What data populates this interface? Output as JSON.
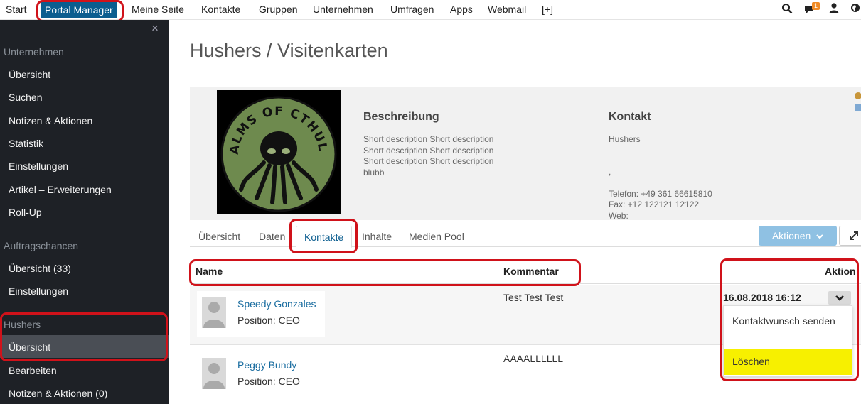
{
  "topnav": {
    "items": [
      "Start",
      "Portal Manager",
      "Meine Seite",
      "Kontakte",
      "Gruppen",
      "Unternehmen",
      "Umfragen",
      "Apps",
      "Webmail",
      "[+]"
    ],
    "active_index": 1,
    "notification_count": "1",
    "icons": [
      "search-icon",
      "chat-icon",
      "user-icon",
      "globe-icon"
    ]
  },
  "sidebar": {
    "close_symbol": "×",
    "sections": [
      {
        "title": "Unternehmen",
        "items": [
          "Übersicht",
          "Suchen",
          "Notizen & Aktionen",
          "Statistik",
          "Einstellungen",
          "Artikel – Erweiterungen",
          "Roll-Up"
        ]
      },
      {
        "title": "Auftragschancen",
        "items": [
          "Übersicht (33)",
          "Einstellungen"
        ]
      },
      {
        "title": "Hushers",
        "items": [
          "Übersicht",
          "Bearbeiten",
          "Notizen & Aktionen (0)"
        ],
        "active_item": "Übersicht"
      }
    ]
  },
  "page": {
    "title": "Hushers / Visitenkarten"
  },
  "card": {
    "logo_text": "REALMS OF CTHULHU",
    "description_heading": "Beschreibung",
    "description_lines": [
      "Short description Short description",
      "Short description Short description",
      "Short description Short description",
      "blubb"
    ],
    "contact_heading": "Kontakt",
    "contact_name": "Hushers",
    "contact_comma": ",",
    "phone": "Telefon: +49 361 66615810",
    "fax": "Fax: +12 122121 12122",
    "web": "Web:"
  },
  "tabs": {
    "items": [
      "Übersicht",
      "Daten",
      "Kontakte",
      "Inhalte",
      "Medien Pool"
    ],
    "active": "Kontakte"
  },
  "actions": {
    "button_label": "Aktionen"
  },
  "table": {
    "columns": [
      "Name",
      "Kommentar",
      "Aktion"
    ],
    "rows": [
      {
        "name": "Speedy Gonzales",
        "position": "Position: CEO",
        "comment": "Test Test Test",
        "datetime": "16.08.2018 16:12"
      },
      {
        "name": "Peggy Bundy",
        "position": "Position: CEO",
        "comment": "AAAALLLLLL",
        "datetime": ""
      }
    ]
  },
  "dropdown": {
    "items": [
      "Kontaktwunsch senden",
      "Löschen"
    ]
  },
  "colors": {
    "nav_active": "#0b5d8f",
    "sidebar_bg": "#1e2126",
    "highlight": "#f7f000",
    "annotation_red": "#d0121a",
    "link": "#1a6da0"
  }
}
